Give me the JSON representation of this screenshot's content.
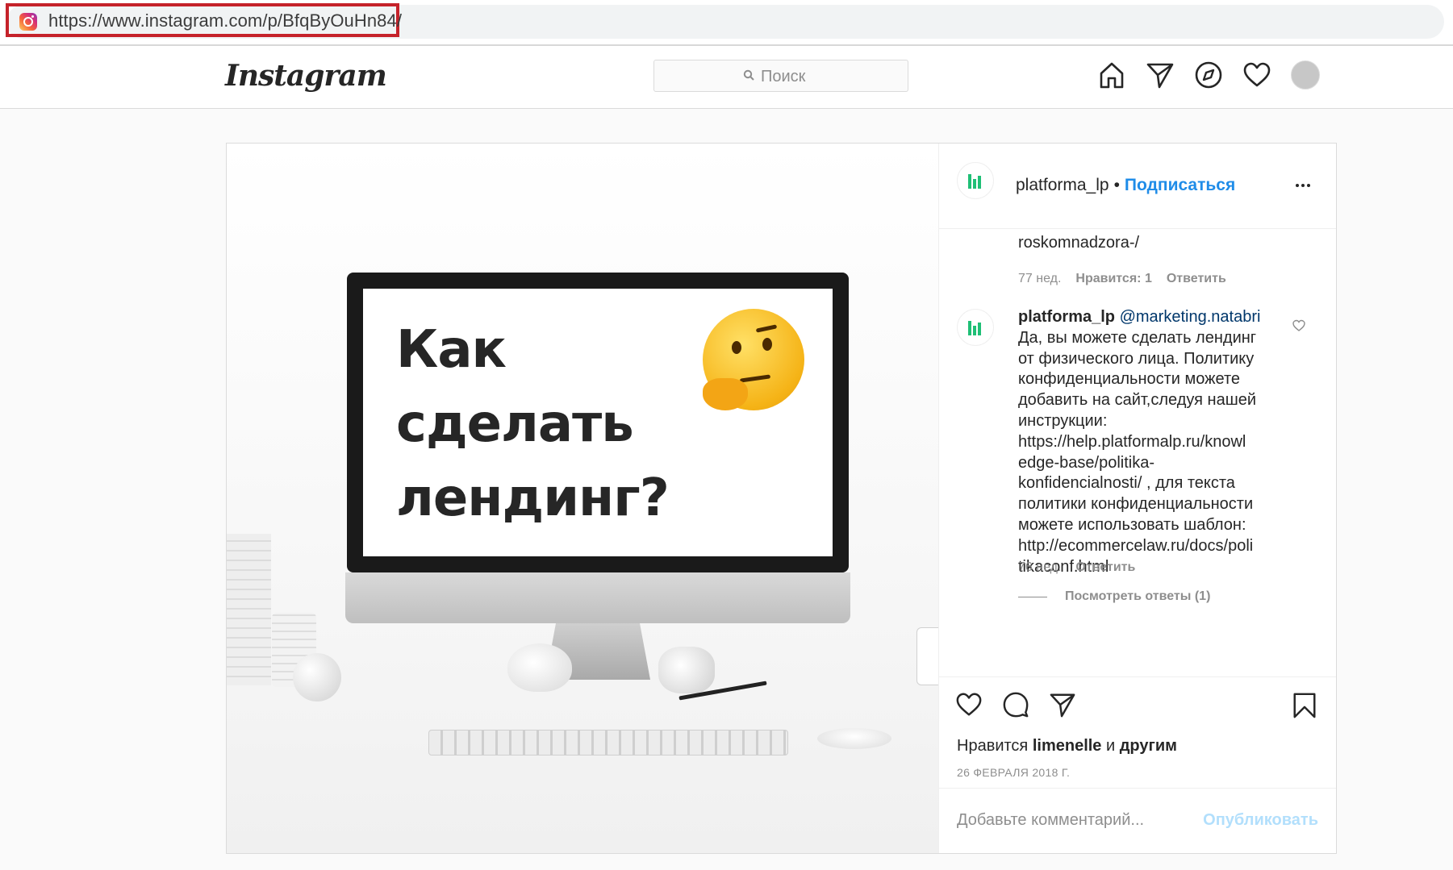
{
  "browser": {
    "url": "https://www.instagram.com/p/BfqByOuHn84/"
  },
  "header": {
    "logo": "Instagram",
    "search_placeholder": "Поиск",
    "nav_icons": [
      "home-icon",
      "direct-icon",
      "explore-icon",
      "activity-heart-icon",
      "profile-avatar"
    ]
  },
  "post": {
    "image": {
      "screen_text": "Как\nсделать\nлендинг?",
      "emoji": "thinking-face"
    },
    "author": {
      "username": "platforma_lp",
      "separator": "•",
      "follow_label": "Подписаться"
    },
    "comments": [
      {
        "text_tail": "roskomnadzora-/",
        "meta": {
          "time": "77 нед.",
          "likes": "Нравится: 1",
          "reply": "Ответить"
        }
      },
      {
        "username": "platforma_lp",
        "mention": "@marketing.natabri",
        "text": "Да, вы можете сделать лендинг\nот физического лица. Политику\nконфиденциальности можете\nдобавить на сайт,следуя нашей\nинструкции:\nhttps://help.platformalp.ru/knowl\nedge-base/politika-\nkonfidencialnosti/ , для текста\nполитики конфиденциальности\nможете использовать шаблон:\nhttp://ecommercelaw.ru/docs/poli\ntikaconf.html",
        "meta": {
          "time": "76 нед.",
          "reply": "Ответить"
        },
        "view_replies": "Посмотреть ответы (1)"
      }
    ],
    "likes": {
      "prefix": "Нравится",
      "user": "limenelle",
      "conj": "и",
      "others": "другим"
    },
    "date": "26 ФЕВРАЛЯ 2018 Г.",
    "add_comment_placeholder": "Добавьте комментарий...",
    "publish_label": "Опубликовать"
  },
  "colors": {
    "accent_blue": "#1f8ce8",
    "brand_green": "#1fbf76",
    "highlight_red": "#c5222a"
  }
}
